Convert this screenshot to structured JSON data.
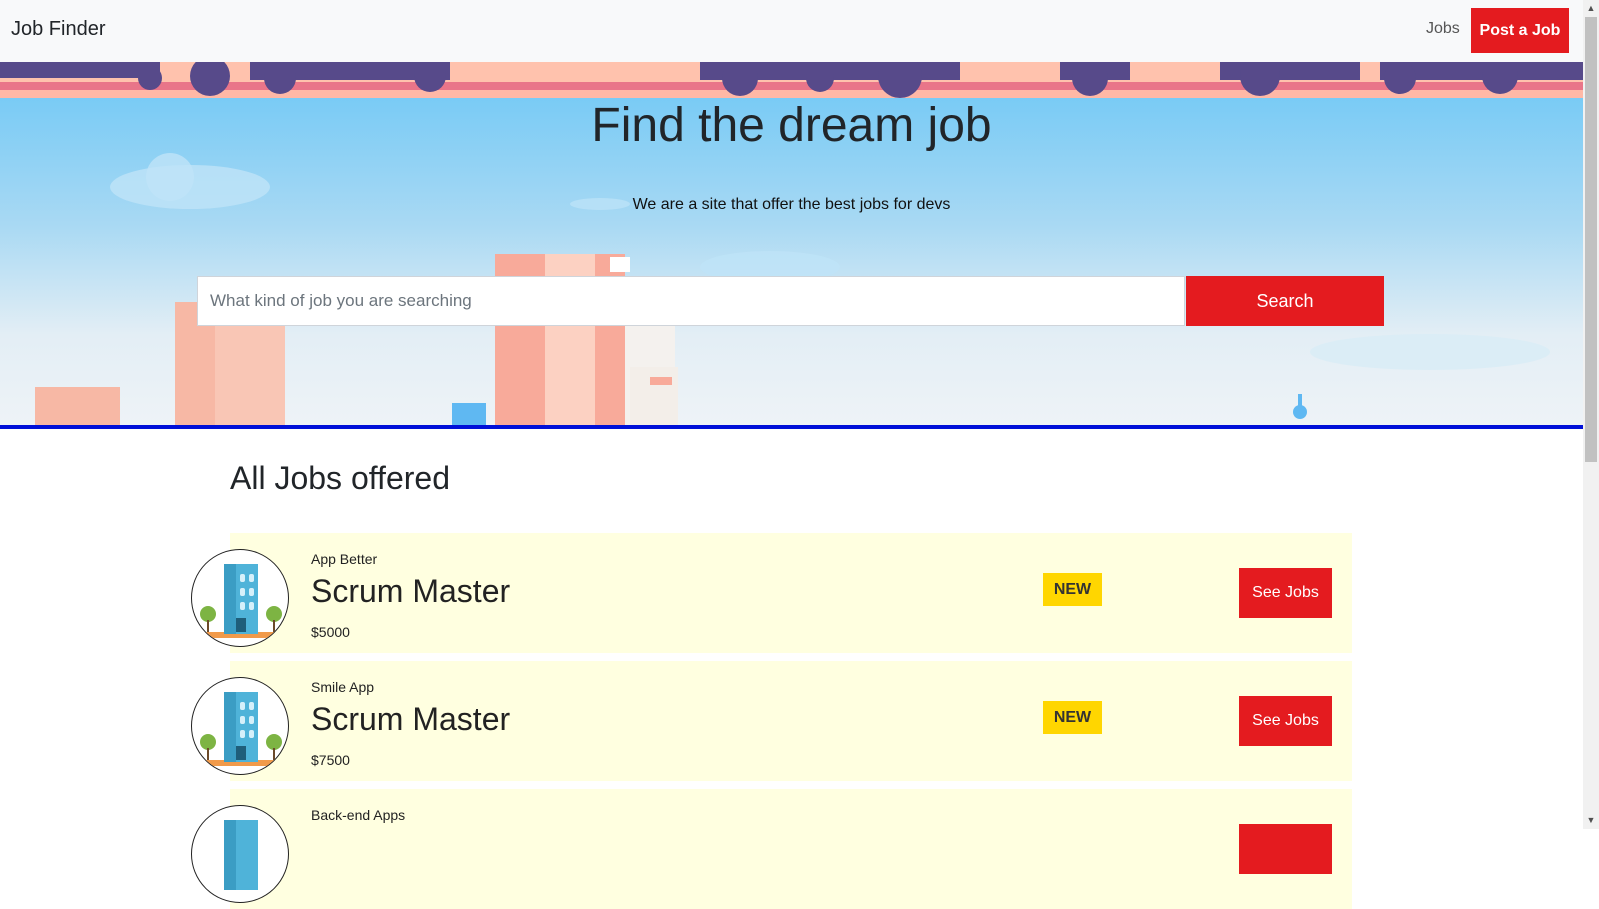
{
  "navbar": {
    "brand": "Job Finder",
    "jobs_link": "Jobs",
    "post_button": "Post a Job"
  },
  "hero": {
    "title": "Find the dream job",
    "subtitle": "We are a site that offer the best jobs for devs",
    "search_placeholder": "What kind of job you are searching",
    "search_value": "",
    "search_button": "Search"
  },
  "jobs_section": {
    "title": "All Jobs offered",
    "jobs": [
      {
        "company": "App Better",
        "title": "Scrum Master",
        "salary": "$5000",
        "badge": "NEW",
        "button": "See Jobs"
      },
      {
        "company": "Smile App",
        "title": "Scrum Master",
        "salary": "$7500",
        "badge": "NEW",
        "button": "See Jobs"
      },
      {
        "company": "Back-end Apps",
        "title": "",
        "salary": "",
        "badge": "",
        "button": ""
      }
    ]
  },
  "colors": {
    "accent_red": "#e41b1f",
    "badge_yellow": "#ffd600",
    "card_bg": "#ffffe0",
    "hero_border": "#0010d8"
  },
  "icons": {
    "company_logo": "office-building-icon",
    "scroll_up": "scroll-up-arrow-icon",
    "scroll_down": "scroll-down-arrow-icon"
  }
}
